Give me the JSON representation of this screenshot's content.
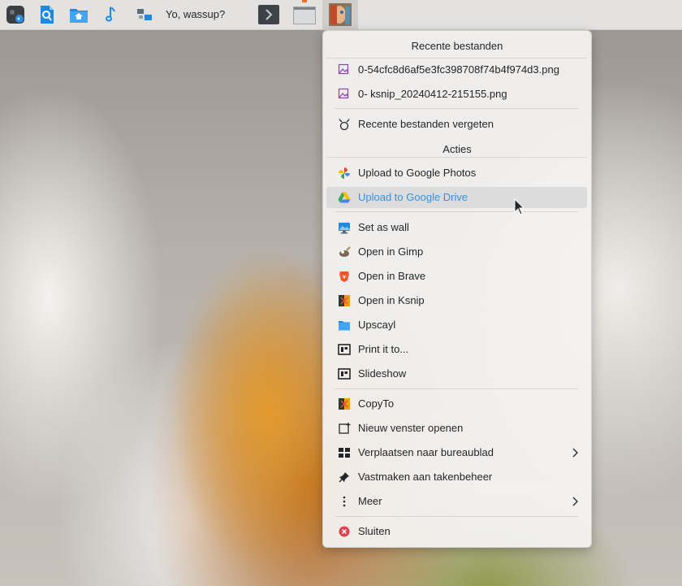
{
  "taskbar": {
    "window_title": "Yo, wassup?",
    "icons": [
      "app-launcher-icon",
      "image-viewer-icon",
      "home-folder-icon",
      "music-note-icon",
      "network-icon",
      "terminal-icon",
      "file-manager-icon",
      "image-thumbnail-icon"
    ]
  },
  "menu": {
    "recent_header": "Recente bestanden",
    "recent_files": [
      "0-54cfc8d6af5e3fc398708f74b4f974d3.png",
      "0- ksnip_20240412-215155.png"
    ],
    "forget_recent": "Recente bestanden vergeten",
    "actions_header": "Acties",
    "actions": [
      "Upload to Google Photos",
      "Upload to Google Drive",
      "Set as wall",
      "Open in Gimp",
      "Open in Brave",
      "Open in Ksnip",
      "Upscayl",
      "Print it to...",
      "Slideshow"
    ],
    "window_items": [
      "CopyTo",
      "Nieuw venster openen",
      "Verplaatsen naar bureaublad",
      "Vastmaken aan takenbeheer",
      "Meer"
    ],
    "close": "Sluiten",
    "highlighted_item": "Upload to Google Drive",
    "highlight_color": "#3b8fd8"
  }
}
